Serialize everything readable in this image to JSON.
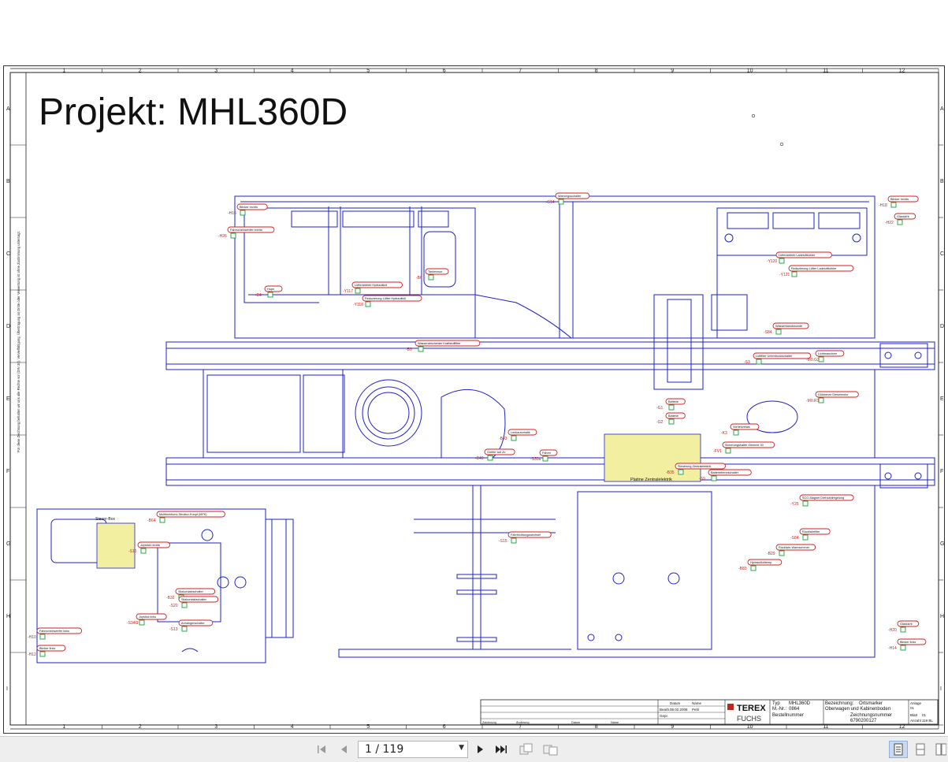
{
  "document": {
    "title": "Projekt: MHL360D",
    "grid_columns": [
      "1",
      "2",
      "3",
      "4",
      "5",
      "6",
      "7",
      "8",
      "9",
      "10",
      "11",
      "12"
    ],
    "grid_rows": [
      "A",
      "B",
      "C",
      "D",
      "E",
      "F",
      "G",
      "H",
      "I"
    ],
    "side_note": "Für diese Zeichnung behalten wir uns alle Rechte vor (DIN 34). Vervielfältigung, Übertragung an Dritte oder Verwertung ist ohne Zustimmung untersagt.",
    "labels": [
      {
        "ref": "-H16",
        "text": "Blinker rechts"
      },
      {
        "ref": "-H26",
        "text": "Fahrscheinwerfer rechts"
      },
      {
        "ref": "-S14",
        "text": "Wartungsschalter"
      },
      {
        "ref": "-H18",
        "text": "Blinker rechts"
      },
      {
        "ref": "-H22",
        "text": "Glassicht"
      },
      {
        "ref": "-B4",
        "text": "Hupe"
      },
      {
        "ref": "-B6",
        "text": "Tankeinsor"
      },
      {
        "ref": "-Y117",
        "text": "Lüfterantrieb Hydrauliköl"
      },
      {
        "ref": "-Y118",
        "text": "Reduzierung Lüfter Hydrauliköl"
      },
      {
        "ref": "-Y120",
        "text": "Lüfterantrieb Ladeluftkühler"
      },
      {
        "ref": "-Y121",
        "text": "Reduzierung Lüfter Ladeluftkühler"
      },
      {
        "ref": "-S84",
        "text": "Wasserstandssonde"
      },
      {
        "ref": "-B9",
        "text": "Wasserabscheider Kraftstofffilter"
      },
      {
        "ref": "-S3",
        "text": "Luftfilter Unterdruckschalter"
      },
      {
        "ref": "-M0.G3",
        "text": "Lichtmaschine"
      },
      {
        "ref": "-G1",
        "text": "Batterie"
      },
      {
        "ref": "-G2",
        "text": "Batterie"
      },
      {
        "ref": "-M0.R1",
        "text": "Glühkerze Dieselmotor"
      },
      {
        "ref": "-B43",
        "text": "Lenkautomatik"
      },
      {
        "ref": "-S30a",
        "text": "Fahrer"
      },
      {
        "ref": "-B40",
        "text": "Greifer auf Zu"
      },
      {
        "ref": "-K3",
        "text": "Vorheizrelais"
      },
      {
        "ref": "-FV1",
        "text": "Sicherungshalter Klemme 30"
      },
      {
        "ref": "-B35",
        "text": "Steuerung Zentralelektrik"
      },
      {
        "ref": "-S9",
        "text": "Batterietrennschalter"
      },
      {
        "ref": "-Y25",
        "text": "SCO-Magnet Drehzahlregelung"
      },
      {
        "ref": "-B64",
        "text": "Multifunktions-Struktur-Knopf (MFK)"
      },
      {
        "ref": "-S16",
        "text": "Joystick rechts"
      },
      {
        "ref": "-S15",
        "text": "Fahrtrichtungswechsel"
      },
      {
        "ref": "-S84",
        "text": "Rückfahrfilter"
      },
      {
        "ref": "-B29",
        "text": "Rückfahr-Warnsummer"
      },
      {
        "ref": "-B83",
        "text": "Hydrauliköltemp."
      },
      {
        "ref": "-H20",
        "text": "Glassicht"
      },
      {
        "ref": "-H14",
        "text": "Blinker links"
      },
      {
        "ref": "-H10",
        "text": "Fahrscheinwerfer links"
      },
      {
        "ref": "-H12",
        "text": "Blinker links"
      },
      {
        "ref": "-S34G",
        "text": "Joystick links"
      },
      {
        "ref": "-S13",
        "text": "Anhängerschalter"
      },
      {
        "ref": "-B32",
        "text": "Sitzkontaktschalter"
      },
      {
        "ref": "-S20",
        "text": "Sitzkontaktschalter"
      }
    ],
    "zones": {
      "central": "Platine Zentralelektrik",
      "cabin": "Steuer-Box"
    }
  },
  "title_block": {
    "brand": "TEREX",
    "sub_brand": "FUCHS",
    "type_label": "Typ",
    "type_value": "MHL360D",
    "mnr_label": "M.-Nr.:",
    "mnr_value": "0864",
    "order_label": "Bestellnummer",
    "designation_label": "Bezeichnung:",
    "designation_value": "Ortsmarker",
    "designation_value2": "Oberwagen und Kabinenboden",
    "drawing_label": "Zeichnungsnummer",
    "drawing_value": "6790200127",
    "date_label": "Datum",
    "name_label": "Name",
    "date_value": "08.02.2008",
    "name_value": "Petri",
    "bearb_label": "Bearb.",
    "gepr_label": "Gepr.",
    "anlage_label": "Anlage",
    "anlage_value": "01",
    "blatt_label": "Blatt",
    "blatt_value": "01",
    "anzahl_label": "Anzahl",
    "anzahl_value": "119 BL",
    "rev_headers": [
      "Zeichnung",
      "Änderung",
      "Datum",
      "Name"
    ]
  },
  "viewer": {
    "page_display": "1 / 119",
    "first_icon": "first-page-icon",
    "prev_icon": "previous-page-icon",
    "next_icon": "next-page-icon",
    "last_icon": "last-page-icon"
  }
}
